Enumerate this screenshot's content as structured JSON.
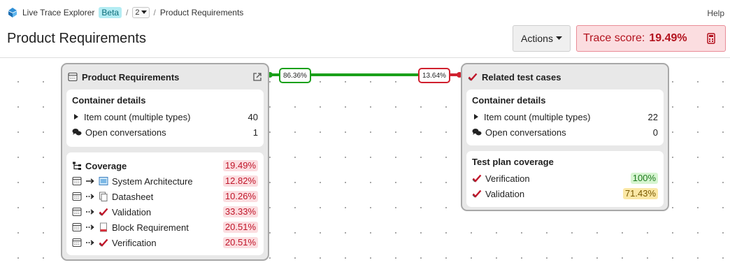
{
  "header": {
    "app_name": "Live Trace Explorer",
    "beta_label": "Beta",
    "version": "2",
    "breadcrumb_current": "Product Requirements",
    "help_label": "Help",
    "page_title": "Product Requirements",
    "actions_label": "Actions",
    "trace_score_label": "Trace score:",
    "trace_score_value": "19.49%"
  },
  "edges": {
    "left_label": "86.36%",
    "right_label": "13.64%",
    "left_color": "#1aa01a",
    "right_color": "#d0202e"
  },
  "source_node": {
    "title": "Product Requirements",
    "details_title": "Container details",
    "item_count_label": "Item count (multiple types)",
    "item_count_value": "40",
    "open_conv_label": "Open conversations",
    "open_conv_value": "1",
    "coverage_title": "Coverage",
    "coverage_total": "19.49%",
    "coverage_rows": [
      {
        "label": "System Architecture",
        "value": "12.82%",
        "icon": "diagram-icon"
      },
      {
        "label": "Datasheet",
        "value": "10.26%",
        "icon": "documents-icon"
      },
      {
        "label": "Validation",
        "value": "33.33%",
        "icon": "checkmark-icon"
      },
      {
        "label": "Block Requirement",
        "value": "20.51%",
        "icon": "requirement-doc-icon"
      },
      {
        "label": "Verification",
        "value": "20.51%",
        "icon": "checkmark-icon"
      }
    ]
  },
  "target_node": {
    "title": "Related test cases",
    "details_title": "Container details",
    "item_count_label": "Item count (multiple types)",
    "item_count_value": "22",
    "open_conv_label": "Open conversations",
    "open_conv_value": "0",
    "coverage_title": "Test plan coverage",
    "coverage_rows": [
      {
        "label": "Verification",
        "value": "100%",
        "status": "green"
      },
      {
        "label": "Validation",
        "value": "71.43%",
        "status": "yellow"
      }
    ]
  }
}
